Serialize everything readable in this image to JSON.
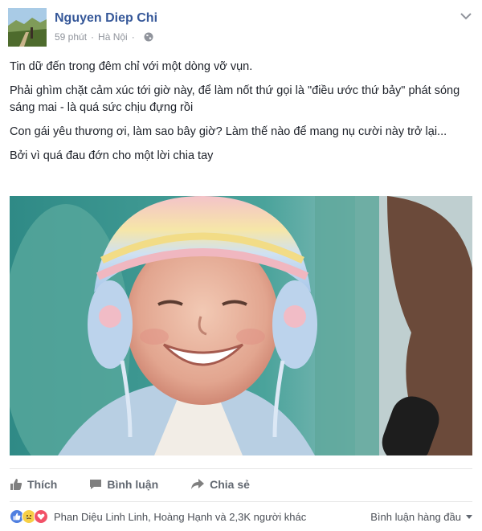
{
  "post": {
    "author": "Nguyen Diep Chi",
    "time": "59 phút",
    "separator": "·",
    "location": "Hà Nội",
    "icons": {
      "avatar": "avatar-landscape-photo",
      "privacy": "globe-icon",
      "menu": "chevron-down-icon"
    },
    "paragraphs": [
      "Tin dữ đến trong đêm chỉ với một dòng vỡ vụn.",
      "Phải ghìm chặt cảm xúc tới giờ này, để làm nốt thứ gọi là \"điều ước thứ bảy\" phát sóng sáng mai - là quá sức chịu đựng rồi",
      "Con gái yêu thương ơi, làm sao bây giờ? Làm thế nào để mang nụ cười này trở lại...",
      "Bởi vì quá đau đớn cho một lời chia tay"
    ],
    "photo": "photo-smiling-girl-knit-hat"
  },
  "actions": {
    "like": "Thích",
    "comment": "Bình luận",
    "share": "Chia sẻ"
  },
  "reactions": {
    "icons": [
      "like-reaction-icon",
      "sad-reaction-icon",
      "love-reaction-icon"
    ],
    "summary": "Phan Diệu Linh Linh, Hoàng Hạnh và 2,3K người khác"
  },
  "comments": {
    "sort_label": "Bình luận hàng đầu"
  },
  "colors": {
    "author": "#365899",
    "meta": "#90949c",
    "action": "#616770",
    "like_blue": "#4f7fe0",
    "love_red": "#f25268",
    "sad_yellow": "#f7d046"
  }
}
